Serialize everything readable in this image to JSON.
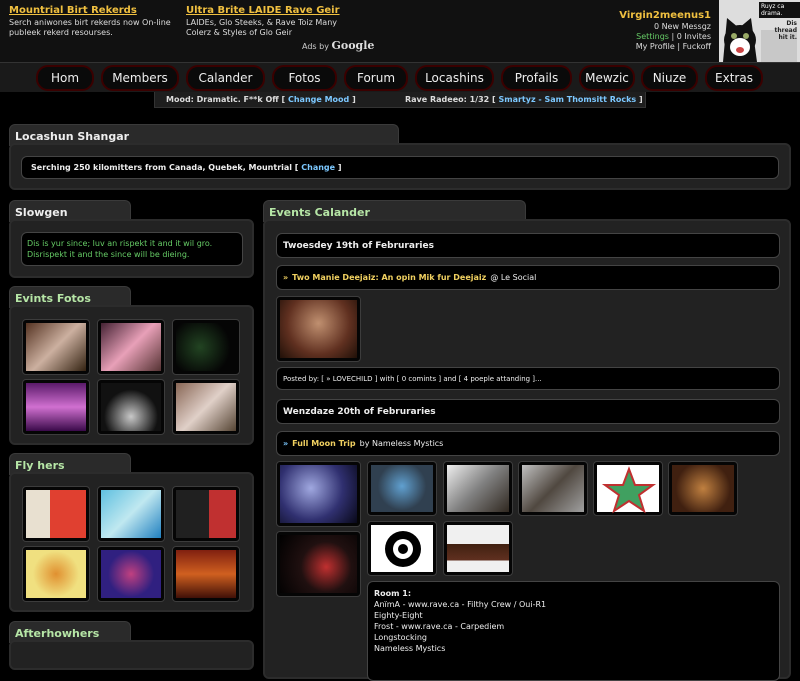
{
  "ads": [
    {
      "title": "Mountrial Birt Rekerds",
      "line1": "Serch aniwones birt rekerds now On-line",
      "line2": "publeek rekerd resourses."
    },
    {
      "title": "Ultra Brite LAIDE Rave Geir",
      "line1": "LAIDEs, Glo Steeks, & Rave Toiz Many",
      "line2": "Colerz & Styles of Glo Geir"
    }
  ],
  "ads_by": {
    "prefix": "Ads by",
    "brand": "Google"
  },
  "user": {
    "name": "Virgin2meenus1",
    "messages": "0 New Messgz",
    "settings": "Settings",
    "invites": "| 0 Invites",
    "profile": "My Profile",
    "sep": "|",
    "logout": "Fuckoff"
  },
  "avatar": {
    "caption": "Ruyz ca drama.",
    "caption2": "Dis thread hit it."
  },
  "nav": [
    "Hom",
    "Members",
    "Calander",
    "Fotos",
    "Forum",
    "Locashins",
    "Profails",
    "Mewzic",
    "Niuze",
    "Extras"
  ],
  "mood": {
    "label": "Mood: Dramatic. F**k Off [",
    "link": "Change Mood",
    "close": "]"
  },
  "radio": {
    "label": "Rave Radeeo: 1/32 [",
    "link": "Smartyz - Sam Thomsitt Rocks",
    "close": "]"
  },
  "location": {
    "title": "Locashun Shangar",
    "text": "Serching 250 kilomitters from Canada, Quebek, Mountrial [",
    "link": "Change",
    "close": "]"
  },
  "slogan": {
    "title": "Slowgen",
    "text": "Dis is yur since; luv an rispekt it and it wil gro. Disrispekt it and the since will be dieing."
  },
  "event_photos": {
    "title": "Evints Fotos"
  },
  "flyers": {
    "title": "Fly hers"
  },
  "afterhours": {
    "title": "Afterhowhers"
  },
  "calendar": {
    "title": "Events Calander",
    "day1": "Twoesdey 19th of Februraries",
    "event1": {
      "arrow": "»",
      "name": "Two Manie Deejaiz: An opin Mik fur Deejaiz",
      "venue": "@ Le Social"
    },
    "posted": {
      "a": "Posted by: [",
      "user": "» LOVECHILD",
      "b": "] with [ 0 comints ] and [ 4 poeple attanding ]..."
    },
    "day2": "Wenzdaze 20th of Februraries",
    "event2": {
      "arrow": "»",
      "name": "Full Moon Trip",
      "by": "by Nameless Mystics"
    },
    "room": {
      "title": "Room 1:",
      "lines": [
        "AnïmA - www.rave.ca - Filthy Crew / Oui-R1",
        "Eighty-Eight",
        "Frost - www.rave.ca - Carpediem",
        "Longstocking",
        "Nameless Mystics"
      ]
    }
  },
  "colors": {
    "accent": "#f0c040",
    "link": "#7cc8ff",
    "slogan": "#6c6",
    "panel": "#222"
  }
}
